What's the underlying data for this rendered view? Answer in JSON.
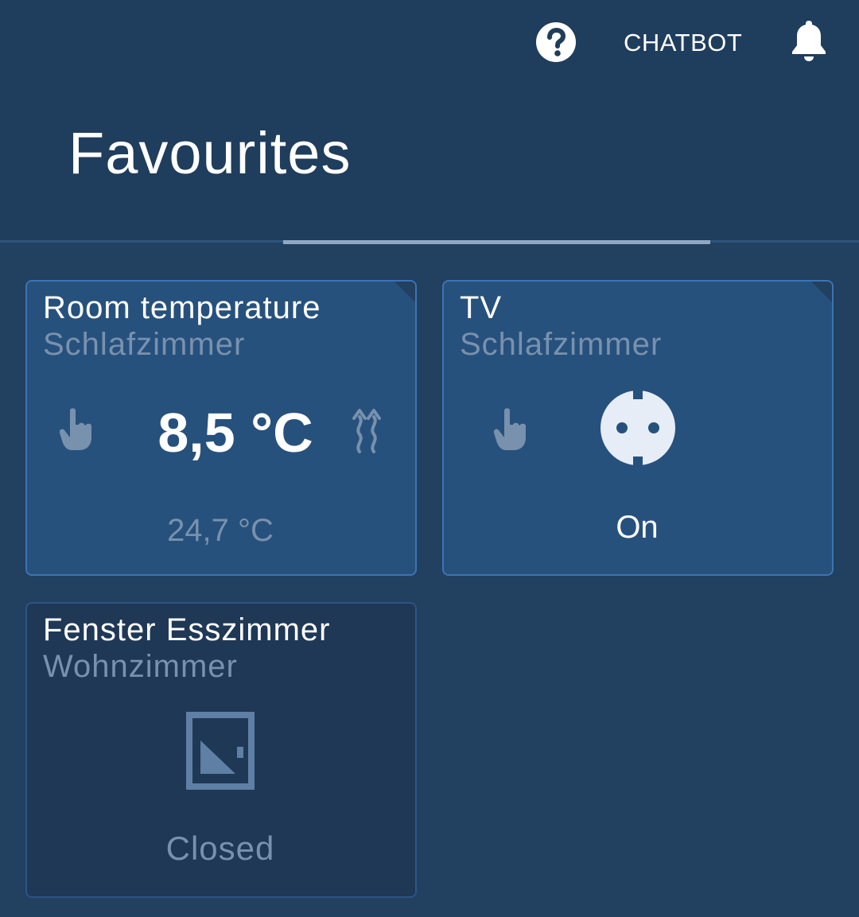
{
  "header": {
    "help_icon": "question-circle-icon",
    "chatbot_label": "CHATBOT",
    "bell_icon": "bell-icon",
    "title": "Favourites"
  },
  "colors": {
    "background": "#22405f",
    "header": "#1f3d5c",
    "card": "#27517d",
    "card_dark": "#1f3856",
    "card_border": "#3b74b4",
    "muted_text": "#7891ad"
  },
  "cards": [
    {
      "title": "Room temperature",
      "subtitle": "Schlafzimmer",
      "mode_icon": "hand-pointer-icon",
      "value": "8,5 °C",
      "status_icon": "heating-icon",
      "actual": "24,7 °C"
    },
    {
      "title": "TV",
      "subtitle": "Schlafzimmer",
      "mode_icon": "hand-pointer-icon",
      "device_icon": "power-socket-icon",
      "state": "On"
    },
    {
      "title": "Fenster Esszimmer",
      "subtitle": "Wohnzimmer",
      "device_icon": "window-contact-icon",
      "state": "Closed"
    }
  ]
}
